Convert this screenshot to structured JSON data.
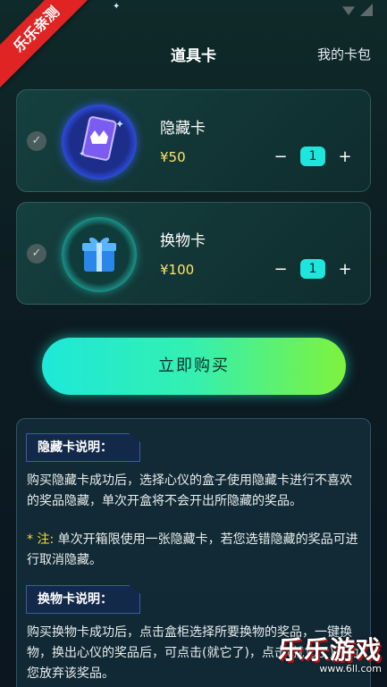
{
  "corner_badge": "乐乐亲测",
  "header": {
    "title": "道具卡",
    "link": "我的卡包"
  },
  "cards": [
    {
      "name": "隐藏卡",
      "price": "¥50",
      "qty": "1",
      "minus": "−",
      "plus": "+"
    },
    {
      "name": "换物卡",
      "price": "¥100",
      "qty": "1",
      "minus": "−",
      "plus": "+"
    }
  ],
  "buy_button": "立即购买",
  "info": {
    "hide_title": "隐藏卡说明：",
    "hide_text": "购买隐藏卡成功后，选择心仪的盒子使用隐藏卡进行不喜欢的奖品隐藏，单次开盒将不会开出所隐藏的奖品。",
    "note_label": "* 注:",
    "note_text": " 单次开箱限使用一张隐藏卡，若您选错隐藏的奖品可进行取消隐藏。",
    "swap_title": "换物卡说明：",
    "swap_text": "购买换物卡成功后，点击盒柜选择所要换物的奖品，一键换物，换出心仪的奖品后，可点击(就它了)，点击(就它了)视为您放弃该奖品。"
  },
  "watermark": {
    "main": "乐乐游戏",
    "url": "www.6ll.com"
  },
  "colors": {
    "accent": "#1ee6dc",
    "price": "#ffe56b",
    "badge": "#e02424"
  }
}
